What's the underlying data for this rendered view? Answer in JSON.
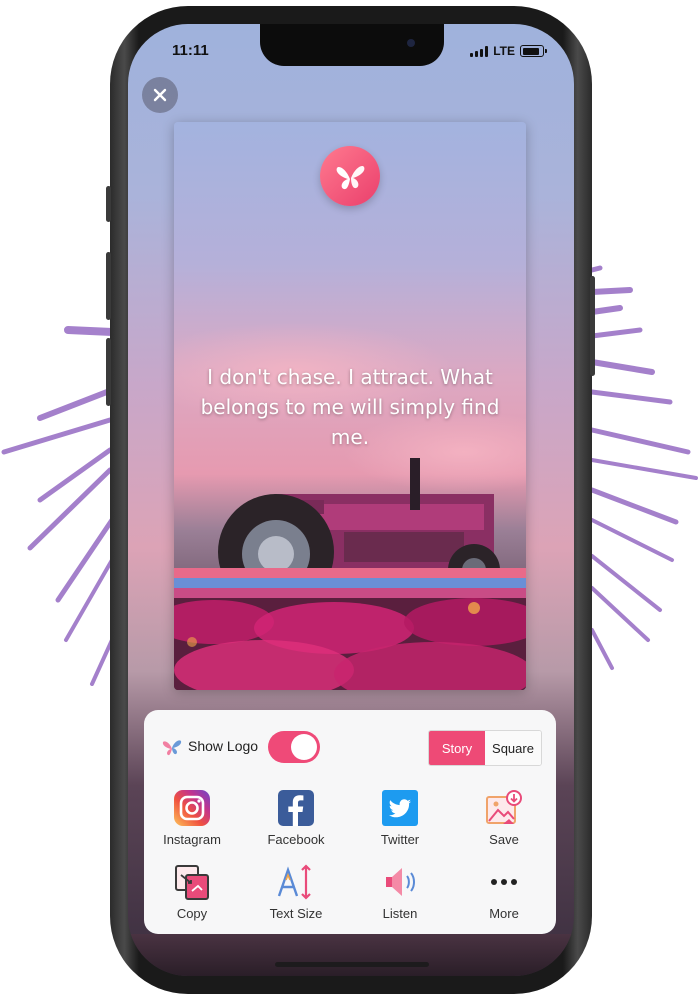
{
  "status_bar": {
    "time": "11:11",
    "network": "LTE"
  },
  "close_button": {
    "icon": "close-icon"
  },
  "card": {
    "logo_icon": "butterfly-icon",
    "quote": "I don't chase. I attract. What belongs to me will simply find me."
  },
  "sheet": {
    "show_logo": {
      "label": "Show Logo",
      "enabled": true
    },
    "format": {
      "options": [
        "Story",
        "Square"
      ],
      "selected": "Story"
    },
    "actions": [
      {
        "label": "Instagram",
        "icon": "instagram-icon"
      },
      {
        "label": "Facebook",
        "icon": "facebook-icon"
      },
      {
        "label": "Twitter",
        "icon": "twitter-icon"
      },
      {
        "label": "Save",
        "icon": "save-image-icon"
      },
      {
        "label": "Copy",
        "icon": "copy-icon"
      },
      {
        "label": "Text Size",
        "icon": "text-size-icon"
      },
      {
        "label": "Listen",
        "icon": "speaker-icon"
      },
      {
        "label": "More",
        "icon": "more-icon"
      }
    ]
  },
  "colors": {
    "accent": "#ee4a76",
    "brush": "#9a70c4"
  }
}
